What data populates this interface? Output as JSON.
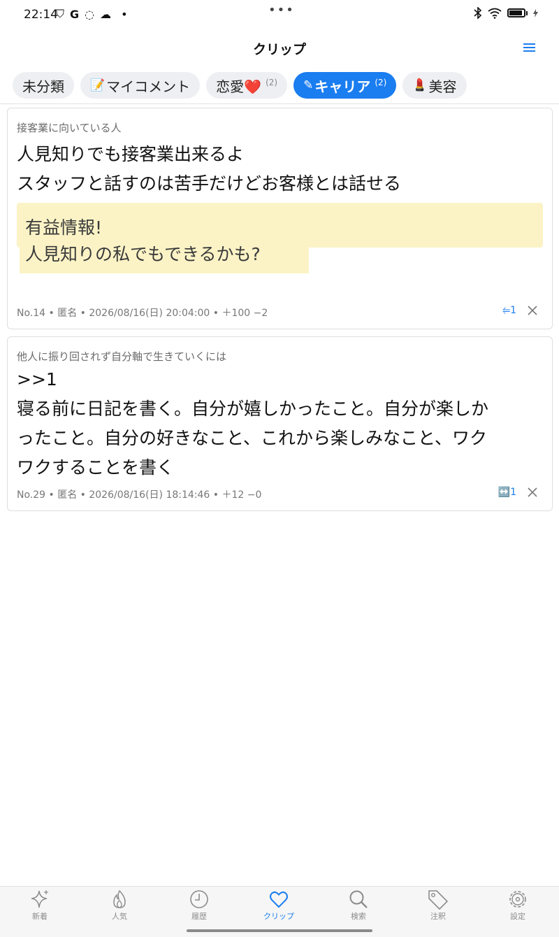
{
  "status_bar": {
    "time": "22:14",
    "left_glyphs": [
      "⛉",
      "G",
      "◌",
      "☁",
      "•"
    ],
    "center_dots": "•••"
  },
  "header": {
    "title": "クリップ",
    "menu_icon": "menu-icon"
  },
  "tabs": [
    {
      "emoji": "",
      "label": "未分類",
      "count": "",
      "active": false
    },
    {
      "emoji": "📝",
      "label": "マイコメント",
      "count": "",
      "active": false
    },
    {
      "emoji": "",
      "label": "恋愛❤️",
      "count": "(2)",
      "active": false
    },
    {
      "emoji": "✎",
      "label": "キャリア",
      "count": "(2)",
      "active": true
    },
    {
      "emoji": "💄",
      "label": "美容",
      "count": "",
      "active": false
    }
  ],
  "clips": [
    {
      "thread_title": "接客業に向いている人",
      "body_lines": [
        "人見知りでも接客業出来るよ",
        "スタッフと話すのは苦手だけどお客様とは話せる"
      ],
      "image_text": [
        "有益情報!",
        "人見知りの私でもできるかも?"
      ],
      "meta": "No.14 • 匿名 • 2026/08/16(日) 20:04:00 • ＋100 −2",
      "reply": "⥢1"
    },
    {
      "thread_title": "他人に振り回されず自分軸で生きていくには",
      "body_lines": [
        ">>1",
        "寝る前に日記を書く。自分が嬉しかったこと。自分が楽しか",
        "ったこと。自分の好きなこと、これから楽しみなこと、ワク",
        "ワクすることを書く"
      ],
      "image_text": [],
      "meta": "No.29 • 匿名 • 2026/08/16(日) 18:14:46 • ＋12 −0",
      "reply": "↔️1"
    }
  ],
  "bottom_tabs": [
    {
      "label": "新着",
      "icon": "sparkle-icon",
      "active": false
    },
    {
      "label": "人気",
      "icon": "flame-icon",
      "active": false
    },
    {
      "label": "履歴",
      "icon": "clock-icon",
      "active": false
    },
    {
      "label": "クリップ",
      "icon": "heart-icon",
      "active": true
    },
    {
      "label": "検索",
      "icon": "search-icon",
      "active": false
    },
    {
      "label": "注釈",
      "icon": "tag-icon",
      "active": false
    },
    {
      "label": "設定",
      "icon": "gear-icon",
      "active": false
    }
  ],
  "colors": {
    "accent": "#1a7df0",
    "tab_bg": "#eeeff2",
    "highlight": "#fbf3c6",
    "meta_text": "#777777"
  }
}
